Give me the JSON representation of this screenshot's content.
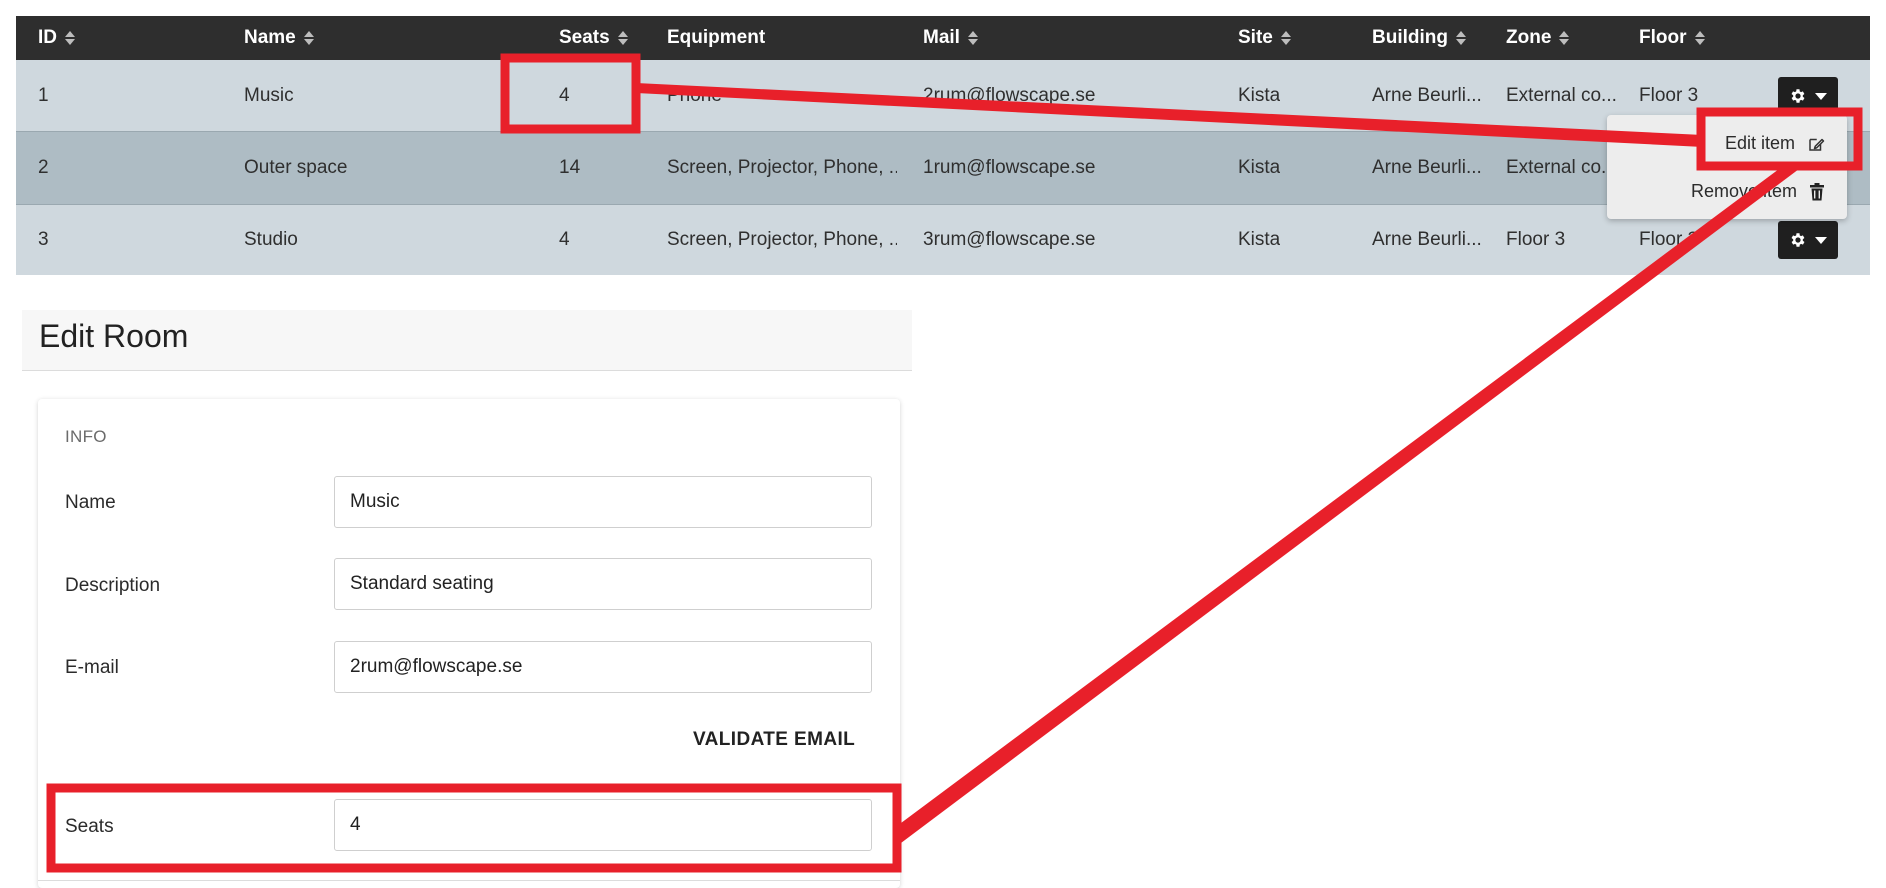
{
  "table": {
    "columns": [
      {
        "label": "ID",
        "sortable": true
      },
      {
        "label": "Name",
        "sortable": true
      },
      {
        "label": "Seats",
        "sortable": true
      },
      {
        "label": "Equipment",
        "sortable": false
      },
      {
        "label": "Mail",
        "sortable": true
      },
      {
        "label": "Site",
        "sortable": true
      },
      {
        "label": "Building",
        "sortable": true
      },
      {
        "label": "Zone",
        "sortable": true
      },
      {
        "label": "Floor",
        "sortable": true
      }
    ],
    "rows": [
      {
        "id": "1",
        "name": "Music",
        "seats": "4",
        "equipment": "Phone",
        "mail": "2rum@flowscape.se",
        "site": "Kista",
        "building": "Arne Beurli...",
        "zone": "External co...",
        "floor": "Floor 3"
      },
      {
        "id": "2",
        "name": "Outer space",
        "seats": "14",
        "equipment": "Screen, Projector, Phone, ...",
        "mail": "1rum@flowscape.se",
        "site": "Kista",
        "building": "Arne Beurli...",
        "zone": "External co...",
        "floor": ""
      },
      {
        "id": "3",
        "name": "Studio",
        "seats": "4",
        "equipment": "Screen, Projector, Phone, ...",
        "mail": "3rum@flowscape.se",
        "site": "Kista",
        "building": "Arne Beurli...",
        "zone": "Floor 3",
        "floor": "Floor 3"
      }
    ]
  },
  "row_menu": {
    "edit_label": "Edit item",
    "remove_label": "Remove item"
  },
  "edit_panel": {
    "title": "Edit Room",
    "section_title": "INFO",
    "fields": {
      "name": {
        "label": "Name",
        "value": "Music"
      },
      "description": {
        "label": "Description",
        "value": "Standard seating"
      },
      "email": {
        "label": "E-mail",
        "value": "2rum@flowscape.se"
      },
      "seats": {
        "label": "Seats",
        "value": "4"
      }
    },
    "validate_label": "VALIDATE EMAIL"
  },
  "colors": {
    "header_bg": "#2e2e2e",
    "row_bg": "#cfd8de",
    "row_selected_bg": "#aebcc4",
    "annotation_red": "#e8202a"
  }
}
